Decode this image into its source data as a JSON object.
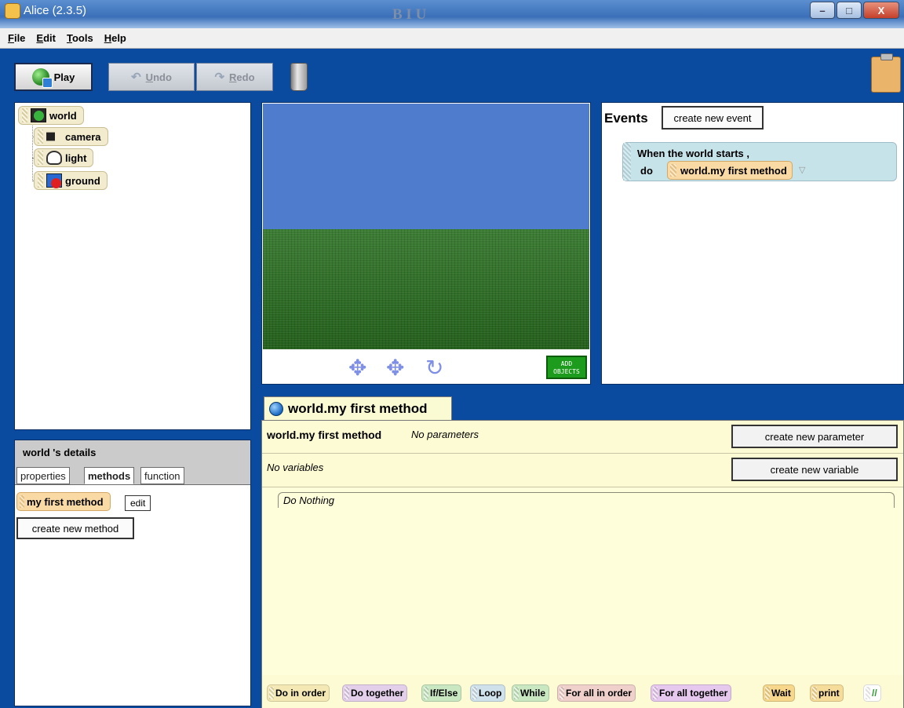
{
  "window": {
    "title": "Alice (2.3.5)",
    "ghost_format_glyphs": "B  I  U",
    "controls": {
      "minimize": "–",
      "maximize": "□",
      "close": "X"
    }
  },
  "menu": [
    "File",
    "Edit",
    "Tools",
    "Help"
  ],
  "toolbar": {
    "play_label": "Play",
    "undo_label": "Undo",
    "redo_label": "Redo"
  },
  "object_tree": {
    "root": "world",
    "children": [
      "camera",
      "light",
      "ground"
    ]
  },
  "scene": {
    "sky_color": "#4f7ccc",
    "ground_color": "#2c6a24",
    "add_objects_label_1": "ADD",
    "add_objects_label_2": "OBJECTS"
  },
  "events": {
    "title": "Events",
    "create_button": "create new event",
    "trigger": "When the world starts ,",
    "do_label": "do",
    "method": "world.my first method",
    "dropdown": "▽"
  },
  "details": {
    "title": "world 's details",
    "tabs": [
      "properties",
      "methods",
      "function"
    ],
    "active_tab": "methods",
    "method_item": "my first method",
    "edit_label": "edit",
    "create_method_button": "create new method"
  },
  "editor": {
    "tab_label": "world.my first method",
    "method_name": "world.my first method",
    "no_params": "No parameters",
    "create_param_button": "create new parameter",
    "no_variables": "No variables",
    "create_var_button": "create new variable",
    "body_placeholder": "Do Nothing"
  },
  "control_tiles": [
    "Do in order",
    "Do together",
    "If/Else",
    "Loop",
    "While",
    "For all in order",
    "For all together",
    "Wait",
    "print",
    "//"
  ]
}
